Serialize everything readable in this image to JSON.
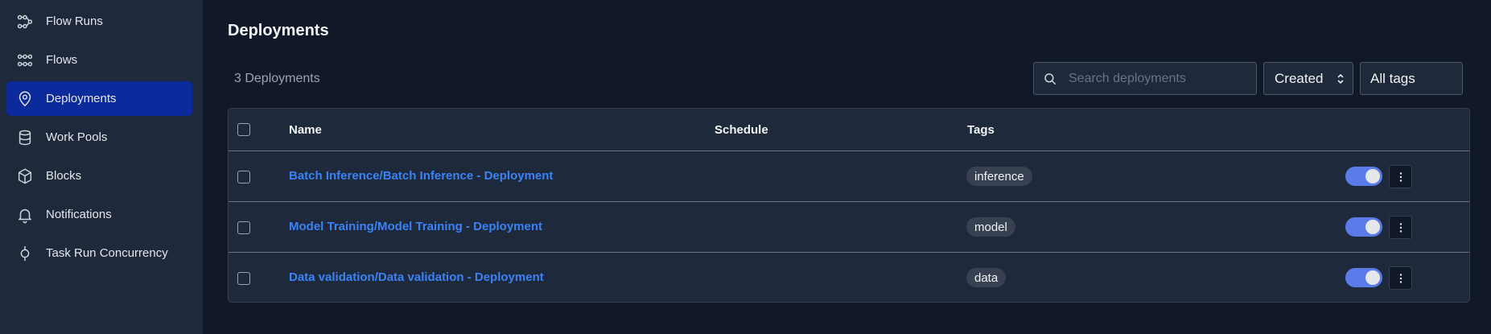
{
  "sidebar": {
    "items": [
      {
        "label": "Flow Runs",
        "icon": "flow-runs-icon"
      },
      {
        "label": "Flows",
        "icon": "flows-icon"
      },
      {
        "label": "Deployments",
        "icon": "map-pin-icon"
      },
      {
        "label": "Work Pools",
        "icon": "database-icon"
      },
      {
        "label": "Blocks",
        "icon": "cube-icon"
      },
      {
        "label": "Notifications",
        "icon": "bell-icon"
      },
      {
        "label": "Task Run Concurrency",
        "icon": "concurrency-icon"
      }
    ],
    "active": "Deployments"
  },
  "page": {
    "title": "Deployments",
    "count_label": "3 Deployments"
  },
  "filters": {
    "search_placeholder": "Search deployments",
    "sort_value": "Created",
    "tags_value": "All tags"
  },
  "table": {
    "columns": [
      "Name",
      "Schedule",
      "Tags"
    ],
    "rows": [
      {
        "name": "Batch Inference/Batch Inference - Deployment",
        "schedule": "",
        "tag": "inference",
        "enabled": true
      },
      {
        "name": "Model Training/Model Training - Deployment",
        "schedule": "",
        "tag": "model",
        "enabled": true
      },
      {
        "name": "Data validation/Data validation - Deployment",
        "schedule": "",
        "tag": "data",
        "enabled": true
      }
    ]
  },
  "colors": {
    "accent": "#3b82f6",
    "active_nav": "#0b2a9c",
    "toggle_on": "#5b7ce8"
  }
}
